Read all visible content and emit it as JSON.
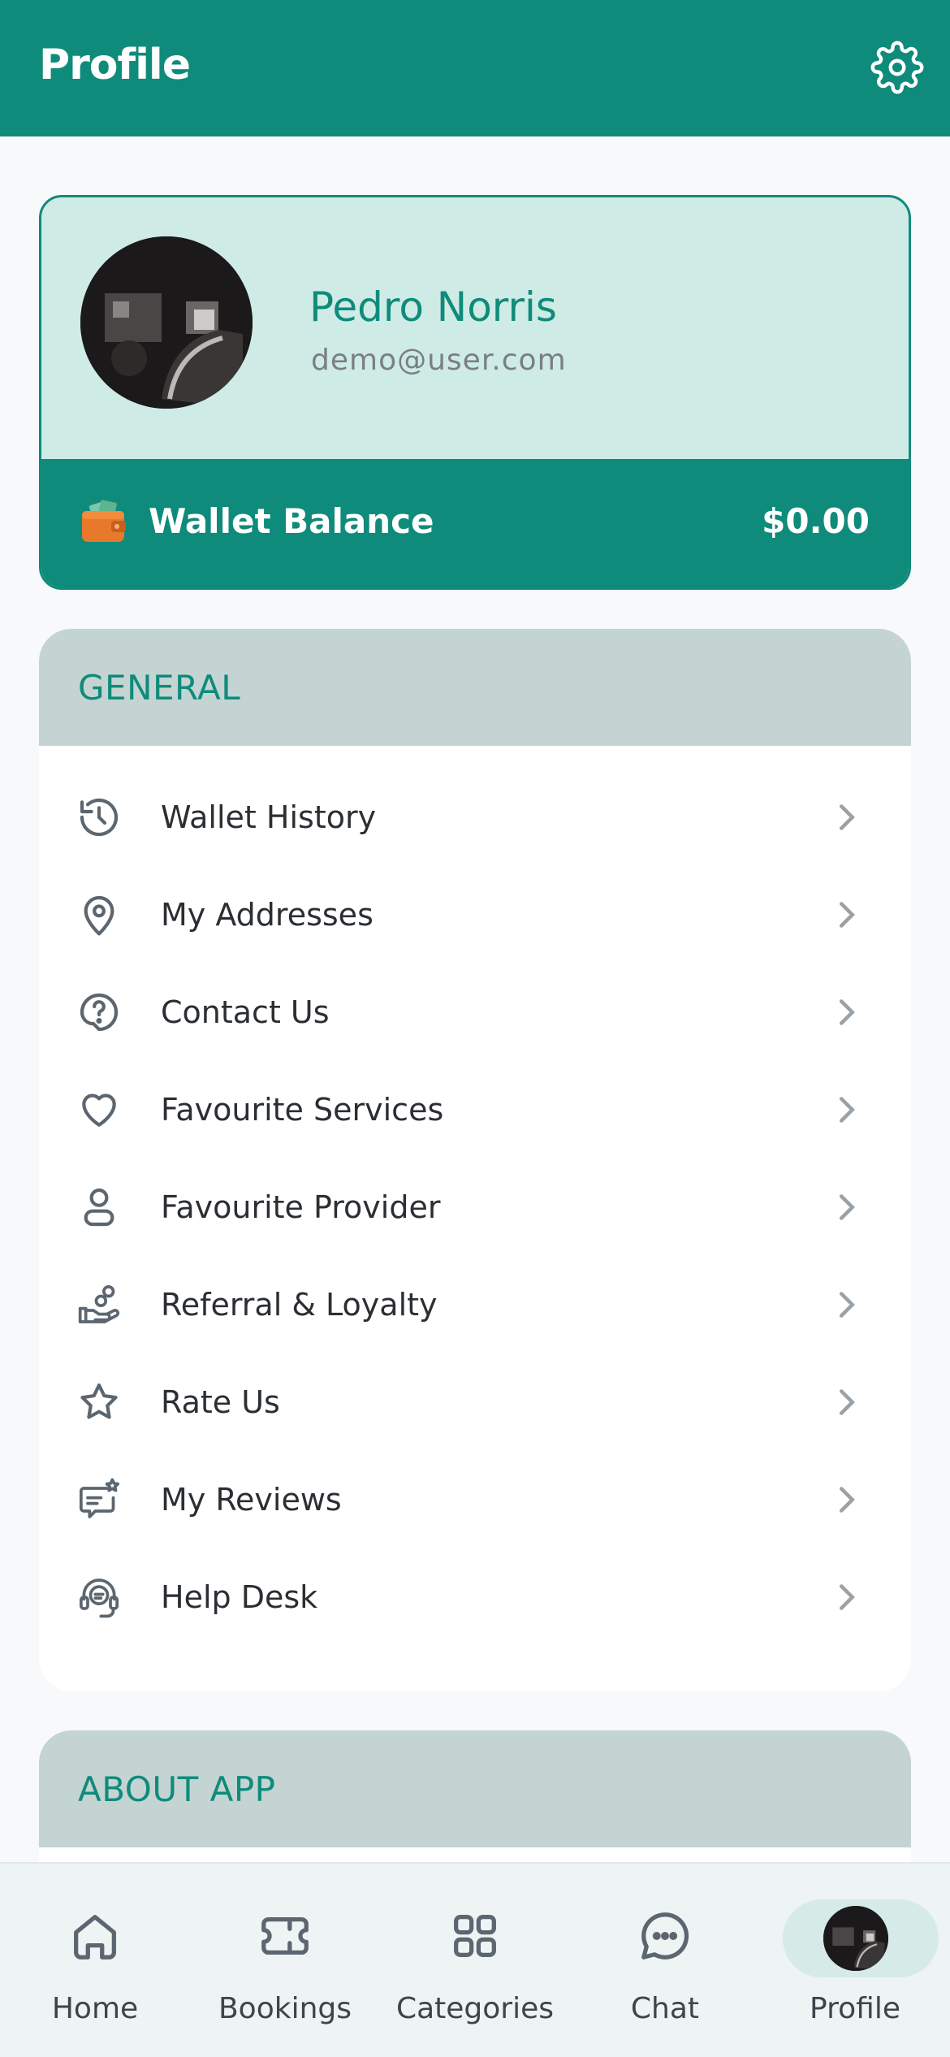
{
  "header": {
    "title": "Profile",
    "settings_icon": "gear-icon"
  },
  "profile": {
    "name": "Pedro Norris",
    "email": "demo@user.com",
    "wallet_label": "Wallet Balance",
    "wallet_amount": "$0.00"
  },
  "general": {
    "title": "GENERAL",
    "items": [
      {
        "label": "Wallet History",
        "icon": "history-icon"
      },
      {
        "label": "My Addresses",
        "icon": "location-pin-icon"
      },
      {
        "label": "Contact Us",
        "icon": "question-bubble-icon"
      },
      {
        "label": "Favourite Services",
        "icon": "heart-icon"
      },
      {
        "label": "Favourite Provider",
        "icon": "user-icon"
      },
      {
        "label": "Referral & Loyalty",
        "icon": "hand-coins-icon"
      },
      {
        "label": "Rate Us",
        "icon": "star-icon"
      },
      {
        "label": "My Reviews",
        "icon": "review-bubble-icon"
      },
      {
        "label": "Help Desk",
        "icon": "headset-icon"
      }
    ]
  },
  "about": {
    "title": "ABOUT APP"
  },
  "nav": {
    "items": [
      {
        "label": "Home",
        "icon": "home-icon"
      },
      {
        "label": "Bookings",
        "icon": "ticket-icon"
      },
      {
        "label": "Categories",
        "icon": "grid-icon"
      },
      {
        "label": "Chat",
        "icon": "chat-icon"
      },
      {
        "label": "Profile",
        "icon": "avatar",
        "active": true
      }
    ]
  },
  "colors": {
    "primary": "#0f8b7b",
    "card_bg": "#cfebe6",
    "section_head": "#c4d4d3"
  }
}
